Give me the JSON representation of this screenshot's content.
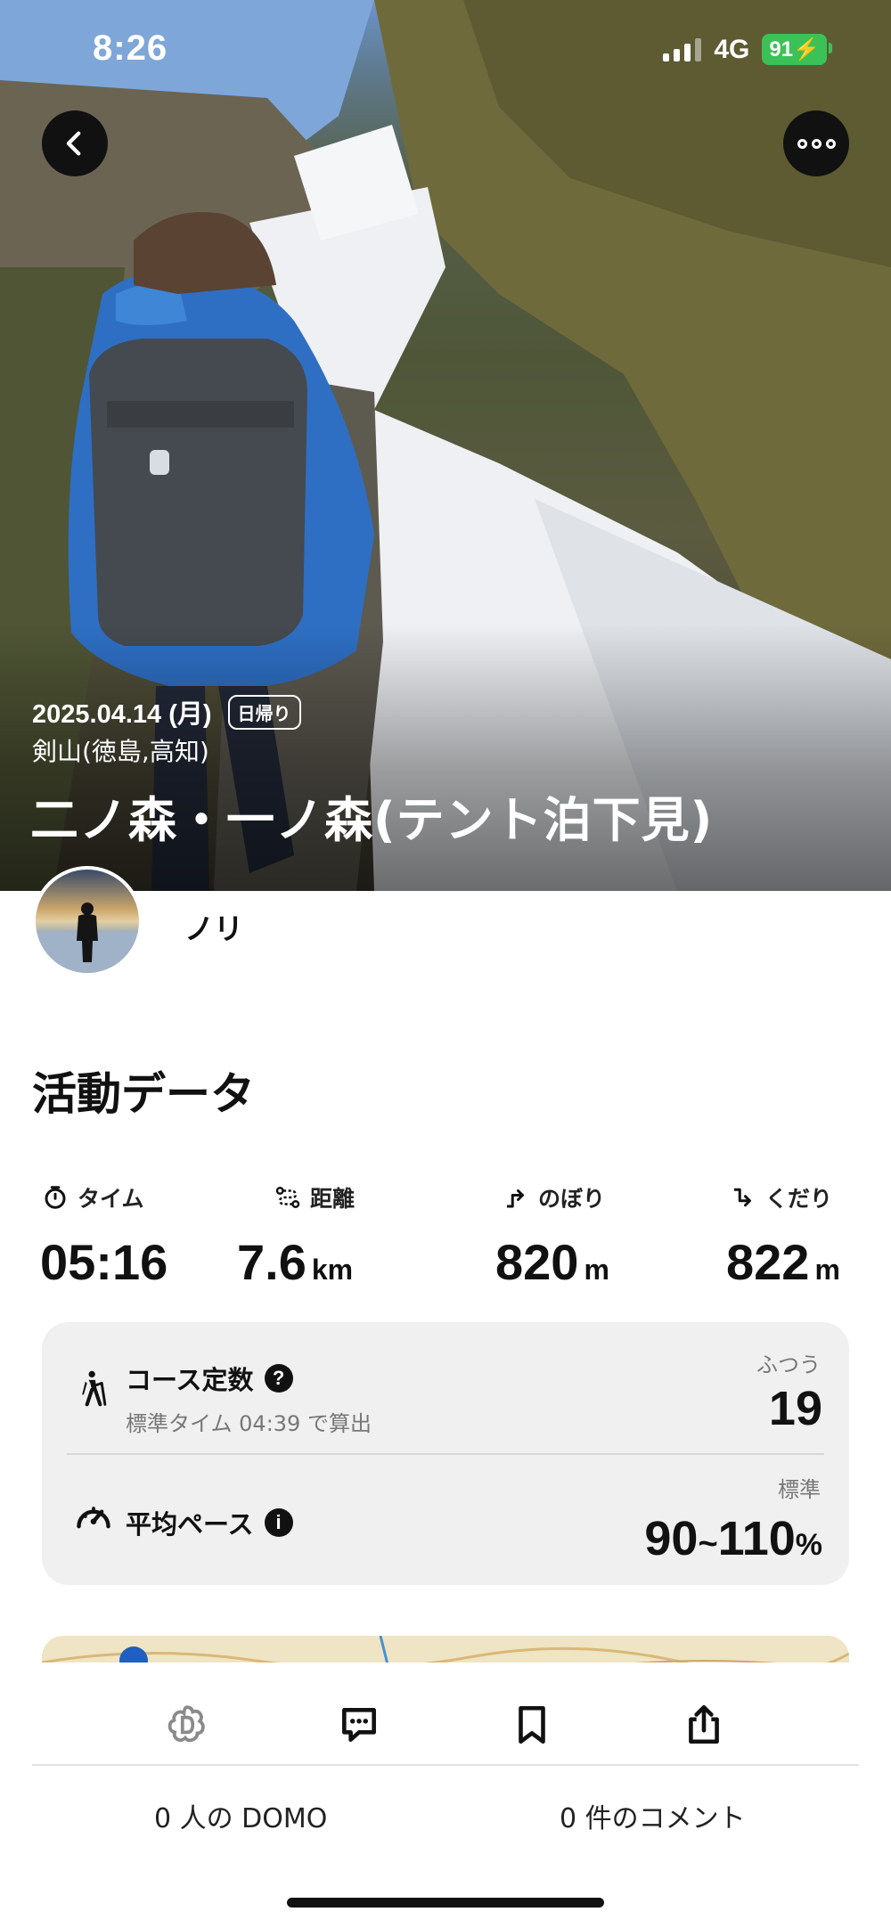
{
  "status_bar": {
    "time": "8:26",
    "network": "4G",
    "battery": "91"
  },
  "hero": {
    "date": "2025.04.14 (月)",
    "badge": "日帰り",
    "location": "剣山(徳島,高知)",
    "title": "二ノ森・一ノ森(テント泊下見)"
  },
  "user": {
    "name": "ノリ"
  },
  "activity": {
    "section_title": "活動データ",
    "stats": [
      {
        "label": "タイム",
        "value": "05:16",
        "unit": "",
        "icon": "stopwatch-icon"
      },
      {
        "label": "距離",
        "value": "7.6",
        "unit": "km",
        "icon": "route-icon"
      },
      {
        "label": "のぼり",
        "value": "820",
        "unit": "m",
        "icon": "ascent-icon"
      },
      {
        "label": "くだり",
        "value": "822",
        "unit": "m",
        "icon": "descent-icon"
      }
    ]
  },
  "course_card": {
    "course_constant_label": "コース定数",
    "course_constant_sub": "標準タイム 04:39 で算出",
    "course_constant_level": "ふつう",
    "course_constant_value": "19",
    "pace_label": "平均ペース",
    "pace_level": "標準",
    "pace_low": "90",
    "pace_sep": "~",
    "pace_high": "110",
    "pace_unit": "%"
  },
  "bottom": {
    "domo_count": "0 人の DOMO",
    "comment_count": "0 件のコメント"
  },
  "colors": {
    "accent_battery": "#3cc156",
    "card_bg": "#f0f0f0",
    "text_primary": "#111111",
    "text_secondary": "#777777"
  }
}
